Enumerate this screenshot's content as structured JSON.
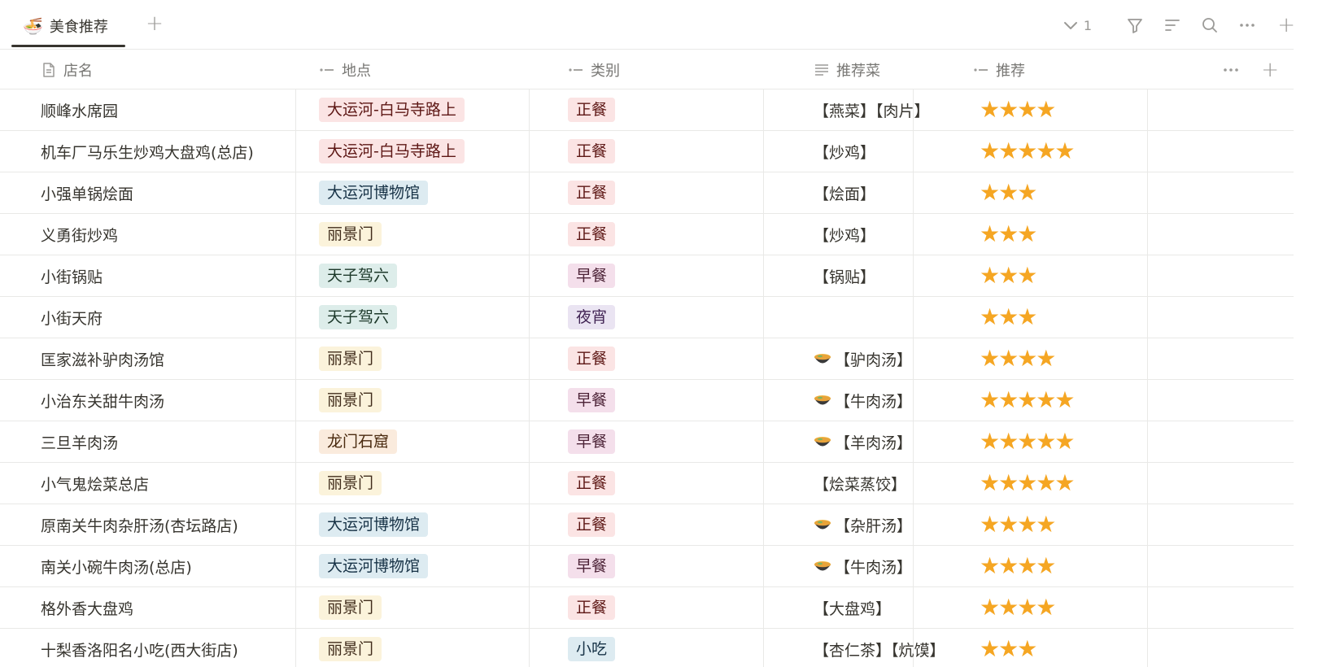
{
  "tab": {
    "emoji": "🍜",
    "label": "美食推荐"
  },
  "toolbar": {
    "group_count": "1"
  },
  "columns": {
    "name": "店名",
    "location": "地点",
    "category": "类别",
    "dish": "推荐菜",
    "rating": "推荐"
  },
  "colors": {
    "red": "#fbe4e4",
    "blue": "#ddebf1",
    "yellow": "#fbf3db",
    "green": "#ddedea",
    "purple": "#eae4f2",
    "orange": "#faebdd",
    "pink": "#f4dfeb",
    "star": "#f5a623"
  },
  "rows": [
    {
      "name": "顺峰水席园",
      "location": "大运河-白马寺路上",
      "location_color": "red",
      "category": "正餐",
      "category_color": "red",
      "dish": "【燕菜】【肉片】",
      "dish_icon": false,
      "stars": 4
    },
    {
      "name": "机车厂马乐生炒鸡大盘鸡(总店)",
      "location": "大运河-白马寺路上",
      "location_color": "red",
      "category": "正餐",
      "category_color": "red",
      "dish": "【炒鸡】",
      "dish_icon": false,
      "stars": 5
    },
    {
      "name": "小强单锅烩面",
      "location": "大运河博物馆",
      "location_color": "blue",
      "category": "正餐",
      "category_color": "red",
      "dish": "【烩面】",
      "dish_icon": false,
      "stars": 3
    },
    {
      "name": "义勇街炒鸡",
      "location": "丽景门",
      "location_color": "yellow",
      "category": "正餐",
      "category_color": "red",
      "dish": "【炒鸡】",
      "dish_icon": false,
      "stars": 3
    },
    {
      "name": "小街锅贴",
      "location": "天子驾六",
      "location_color": "green",
      "category": "早餐",
      "category_color": "pink",
      "dish": "【锅贴】",
      "dish_icon": false,
      "stars": 3
    },
    {
      "name": "小街天府",
      "location": "天子驾六",
      "location_color": "green",
      "category": "夜宵",
      "category_color": "purple",
      "dish": "",
      "dish_icon": false,
      "stars": 3
    },
    {
      "name": "匡家滋补驴肉汤馆",
      "location": "丽景门",
      "location_color": "yellow",
      "category": "正餐",
      "category_color": "red",
      "dish": "【驴肉汤】",
      "dish_icon": true,
      "stars": 4
    },
    {
      "name": "小治东关甜牛肉汤",
      "location": "丽景门",
      "location_color": "yellow",
      "category": "早餐",
      "category_color": "pink",
      "dish": "【牛肉汤】",
      "dish_icon": true,
      "stars": 5
    },
    {
      "name": "三旦羊肉汤",
      "location": "龙门石窟",
      "location_color": "orange",
      "category": "早餐",
      "category_color": "pink",
      "dish": "【羊肉汤】",
      "dish_icon": true,
      "stars": 5
    },
    {
      "name": "小气鬼烩菜总店",
      "location": "丽景门",
      "location_color": "yellow",
      "category": "正餐",
      "category_color": "red",
      "dish": "【烩菜蒸饺】",
      "dish_icon": false,
      "stars": 5
    },
    {
      "name": "原南关牛肉杂肝汤(杏坛路店)",
      "location": "大运河博物馆",
      "location_color": "blue",
      "category": "正餐",
      "category_color": "red",
      "dish": "【杂肝汤】",
      "dish_icon": true,
      "stars": 4
    },
    {
      "name": "南关小碗牛肉汤(总店)",
      "location": "大运河博物馆",
      "location_color": "blue",
      "category": "早餐",
      "category_color": "pink",
      "dish": "【牛肉汤】",
      "dish_icon": true,
      "stars": 4
    },
    {
      "name": "格外香大盘鸡",
      "location": "丽景门",
      "location_color": "yellow",
      "category": "正餐",
      "category_color": "red",
      "dish": "【大盘鸡】",
      "dish_icon": false,
      "stars": 4
    },
    {
      "name": "十梨香洛阳名小吃(西大街店)",
      "location": "丽景门",
      "location_color": "yellow",
      "category": "小吃",
      "category_color": "blue",
      "dish": "【杏仁茶】【炕馍】",
      "dish_icon": false,
      "stars": 3
    }
  ]
}
